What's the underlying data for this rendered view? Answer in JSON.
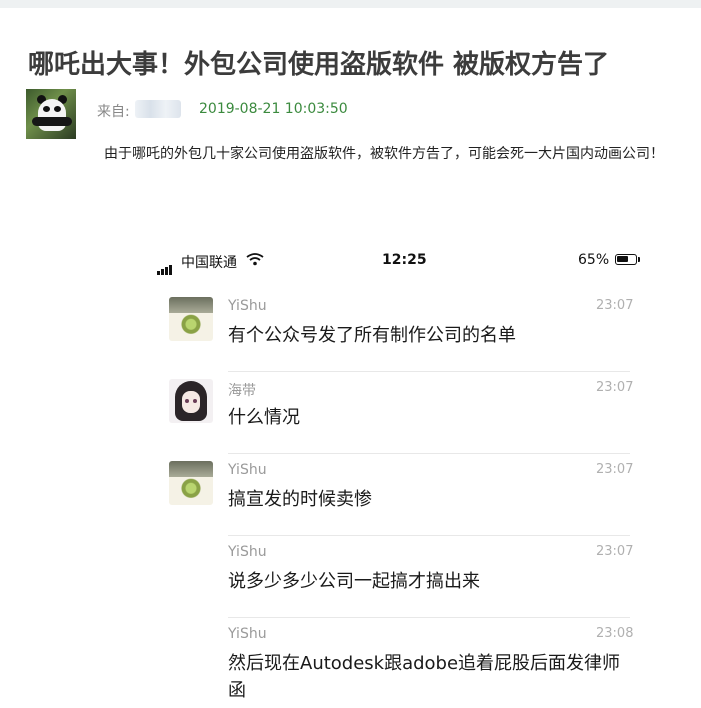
{
  "article": {
    "title": "哪吒出大事！外包公司使用盗版软件 被版权方告了",
    "from_label": "来自:",
    "date": "2019-08-21 10:03:50",
    "description": "由于哪吒的外包几十家公司使用盗版软件，被软件方告了，可能会死一大片国内动画公司！"
  },
  "phone": {
    "carrier": "中国联通",
    "time": "12:25",
    "battery_pct": "65%",
    "battery_level": 0.65,
    "icons": {
      "signal": "signal-bars-icon",
      "wifi": "wifi-icon",
      "battery": "battery-icon"
    }
  },
  "messages": [
    {
      "name": "YiShu",
      "time": "23:07",
      "text": "有个公众号发了所有制作公司的名单",
      "avatar": "green-eye-avatar"
    },
    {
      "name": "海带",
      "time": "23:07",
      "text": "什么情况",
      "avatar": "anime-girl-avatar"
    },
    {
      "name": "YiShu",
      "time": "23:07",
      "text": "搞宣发的时候卖惨",
      "avatar": "green-eye-avatar"
    },
    {
      "name": "YiShu",
      "time": "23:07",
      "text": "说多少多少公司一起搞才搞出来",
      "avatar": ""
    },
    {
      "name": "YiShu",
      "time": "23:08",
      "text": "然后现在Autodesk跟adobe追着屁股后面发律师函",
      "avatar": ""
    }
  ],
  "colors": {
    "date_green": "#3b8a3e",
    "title_gray": "#3c3c3c",
    "page_top_bar": "#eef1f2"
  }
}
